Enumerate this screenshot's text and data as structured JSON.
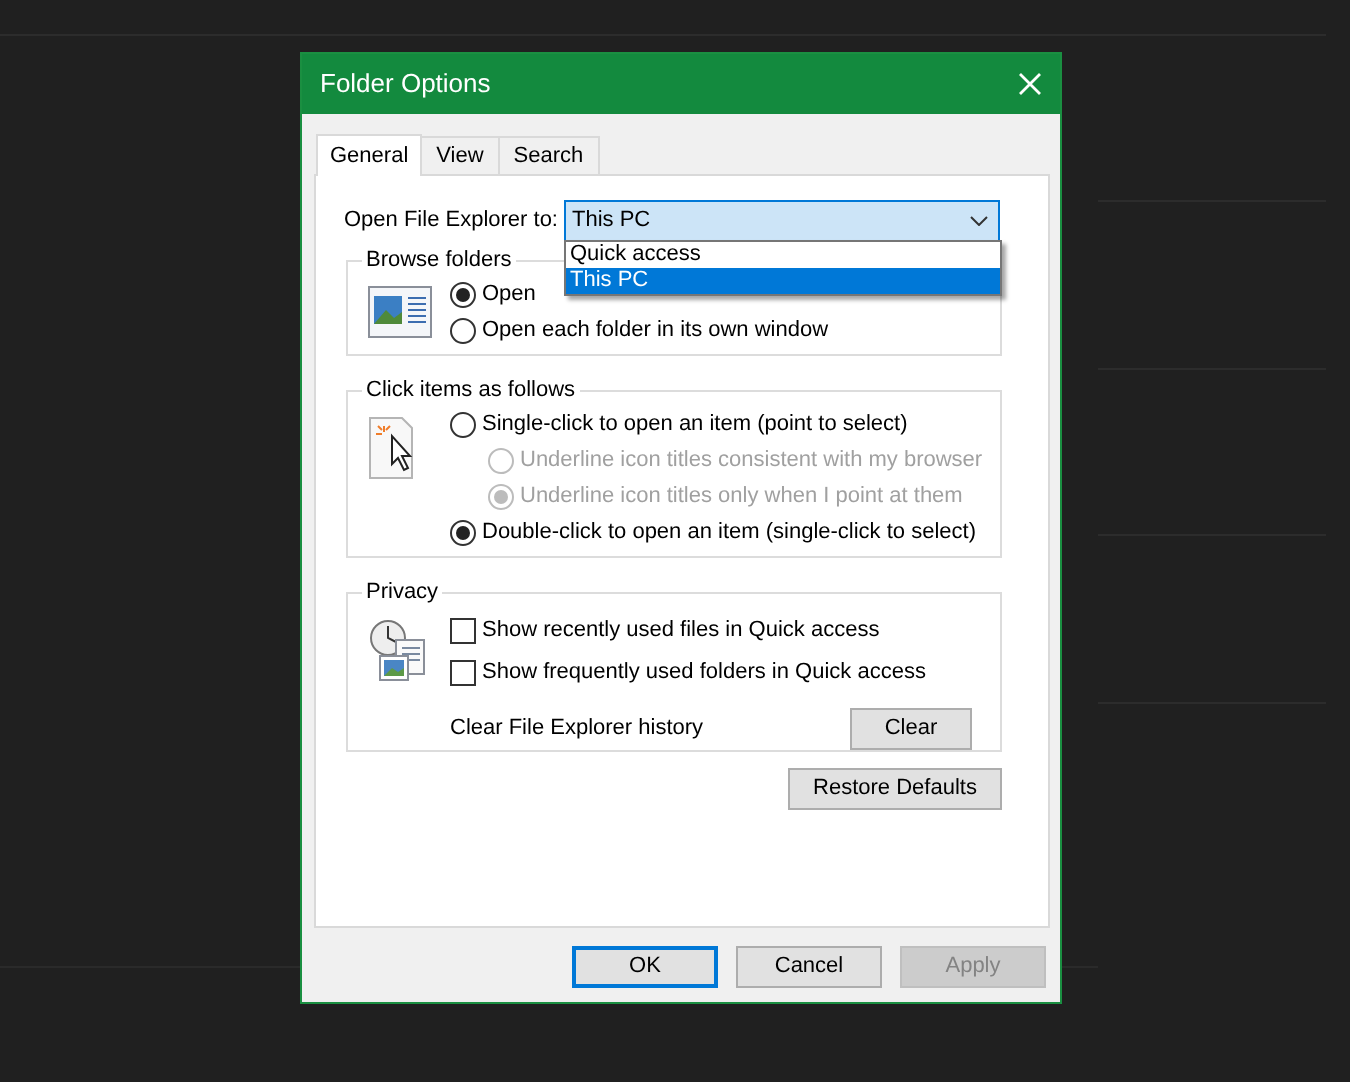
{
  "window": {
    "title": "Folder Options"
  },
  "tabs": [
    {
      "label": "General",
      "selected": true
    },
    {
      "label": "View",
      "selected": false
    },
    {
      "label": "Search",
      "selected": false
    }
  ],
  "open_to": {
    "label": "Open File Explorer to:",
    "value": "This PC",
    "expanded": true,
    "options": [
      {
        "label": "Quick access",
        "selected": false
      },
      {
        "label": "This PC",
        "selected": true
      }
    ]
  },
  "groups": [
    {
      "title": "Browse folders",
      "items": [
        {
          "kind": "radio",
          "label": "Open",
          "selected": true,
          "disabled": false
        },
        {
          "kind": "radio",
          "label": "Open each folder in its own window",
          "selected": false,
          "disabled": false
        }
      ]
    },
    {
      "title": "Click items as follows",
      "items": [
        {
          "kind": "radio",
          "label": "Single-click to open an item (point to select)",
          "selected": false,
          "disabled": false,
          "children": [
            {
              "kind": "radio",
              "label": "Underline icon titles consistent with my browser",
              "selected": false,
              "disabled": true
            },
            {
              "kind": "radio",
              "label": "Underline icon titles only when I point at them",
              "selected": true,
              "disabled": true
            }
          ]
        },
        {
          "kind": "radio",
          "label": "Double-click to open an item (single-click to select)",
          "selected": true,
          "disabled": false
        }
      ]
    },
    {
      "title": "Privacy",
      "items": [
        {
          "kind": "checkbox",
          "label": "Show recently used files in Quick access",
          "checked": false
        },
        {
          "kind": "checkbox",
          "label": "Show frequently used folders in Quick access",
          "checked": false
        },
        {
          "kind": "action",
          "label": "Clear File Explorer history",
          "button": "Clear"
        }
      ]
    }
  ],
  "restore_button": "Restore Defaults",
  "buttons": [
    {
      "label": "OK",
      "default": true,
      "disabled": false
    },
    {
      "label": "Cancel",
      "default": false,
      "disabled": false
    },
    {
      "label": "Apply",
      "default": false,
      "disabled": true
    }
  ]
}
